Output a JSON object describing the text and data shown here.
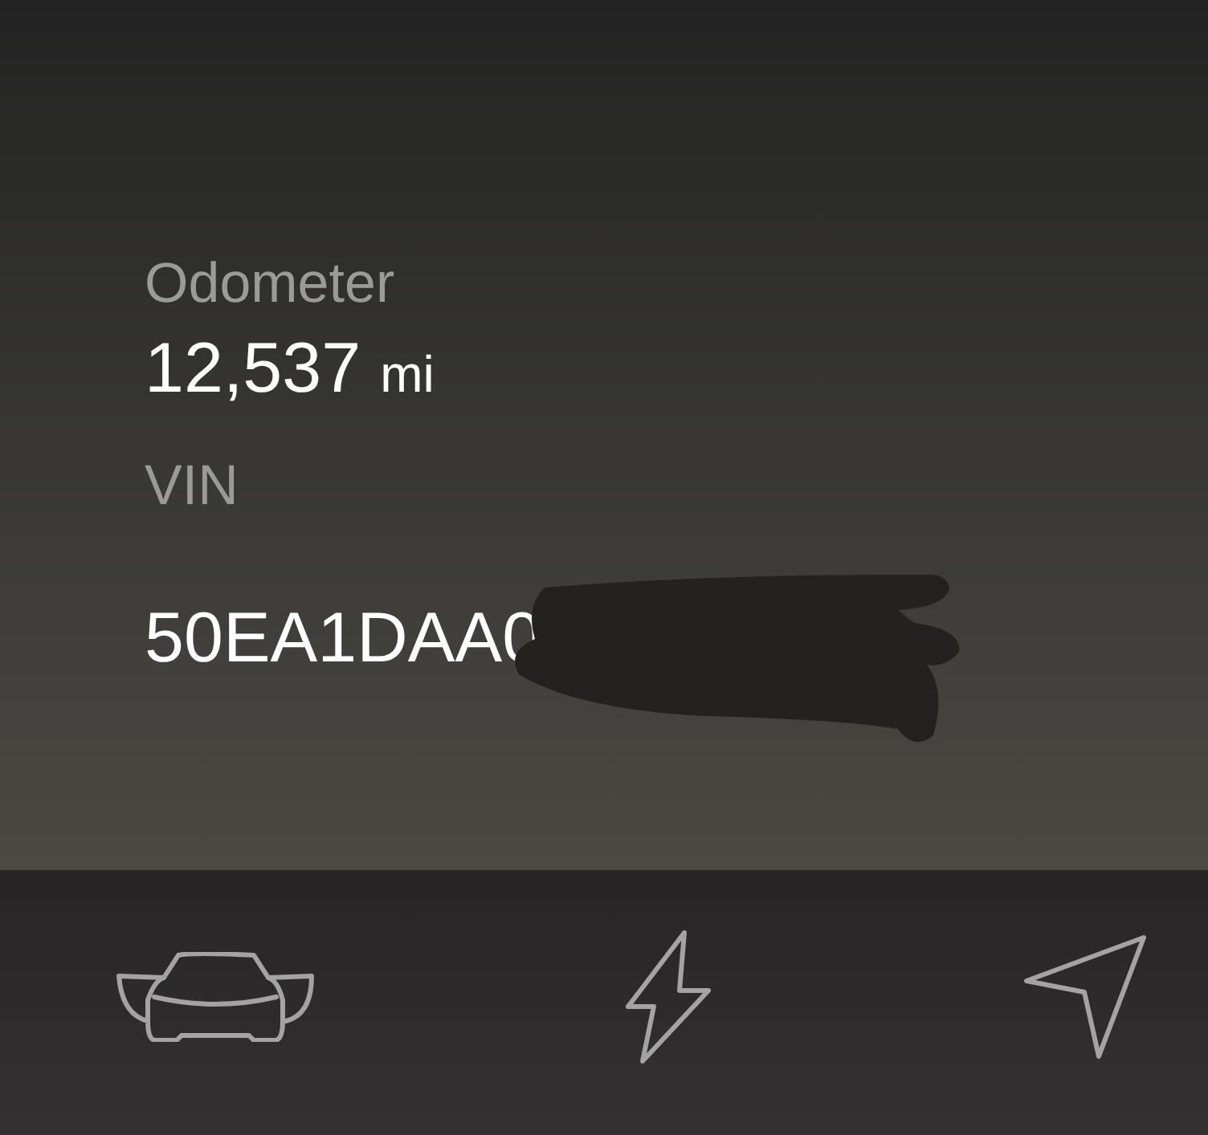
{
  "fields": [
    {
      "label": "Odometer",
      "value": "12,537",
      "unit": "mi"
    },
    {
      "label": "VIN",
      "value": "50EA1DAA0",
      "redacted": true
    }
  ],
  "tab_bar": [
    {
      "kind": "car"
    },
    {
      "kind": "bolt"
    },
    {
      "kind": "navigate"
    }
  ]
}
